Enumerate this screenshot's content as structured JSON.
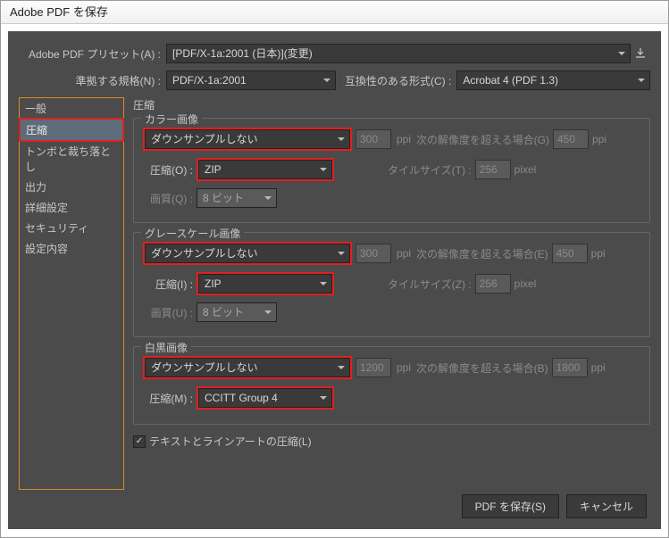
{
  "window_title": "Adobe PDF を保存",
  "preset_label": "Adobe PDF プリセット(A) :",
  "preset_value": "[PDF/X-1a:2001 (日本)](変更)",
  "standard_label": "準拠する規格(N) :",
  "standard_value": "PDF/X-1a:2001",
  "compat_label": "互換性のある形式(C) :",
  "compat_value": "Acrobat 4 (PDF 1.3)",
  "sidebar": {
    "items": [
      "一般",
      "圧縮",
      "トンボと裁ち落とし",
      "出力",
      "詳細設定",
      "セキュリティ",
      "設定内容"
    ],
    "selected_index": 1
  },
  "main_title": "圧縮",
  "groups": {
    "color": {
      "legend": "カラー画像",
      "downsample": "ダウンサンプルしない",
      "res": "300",
      "res_unit": "ppi",
      "thresh_label": "次の解像度を超える場合(G)",
      "thresh": "450",
      "thresh_unit": "ppi",
      "comp_label": "圧縮(O) :",
      "comp_value": "ZIP",
      "tile_label": "タイルサイズ(T) :",
      "tile_value": "256",
      "tile_unit": "pixel",
      "quality_label": "画質(Q) :",
      "quality_value": "8 ビット"
    },
    "gray": {
      "legend": "グレースケール画像",
      "downsample": "ダウンサンプルしない",
      "res": "300",
      "res_unit": "ppi",
      "thresh_label": "次の解像度を超える場合(E)",
      "thresh": "450",
      "thresh_unit": "ppi",
      "comp_label": "圧縮(I) :",
      "comp_value": "ZIP",
      "tile_label": "タイルサイズ(Z) :",
      "tile_value": "256",
      "tile_unit": "pixel",
      "quality_label": "画質(U) :",
      "quality_value": "8 ビット"
    },
    "mono": {
      "legend": "白黒画像",
      "downsample": "ダウンサンプルしない",
      "res": "1200",
      "res_unit": "ppi",
      "thresh_label": "次の解像度を超える場合(B)",
      "thresh": "1800",
      "thresh_unit": "ppi",
      "comp_label": "圧縮(M) :",
      "comp_value": "CCITT Group 4"
    }
  },
  "compress_text_label": "テキストとラインアートの圧縮(L)",
  "footer": {
    "save": "PDF を保存(S)",
    "cancel": "キャンセル"
  }
}
